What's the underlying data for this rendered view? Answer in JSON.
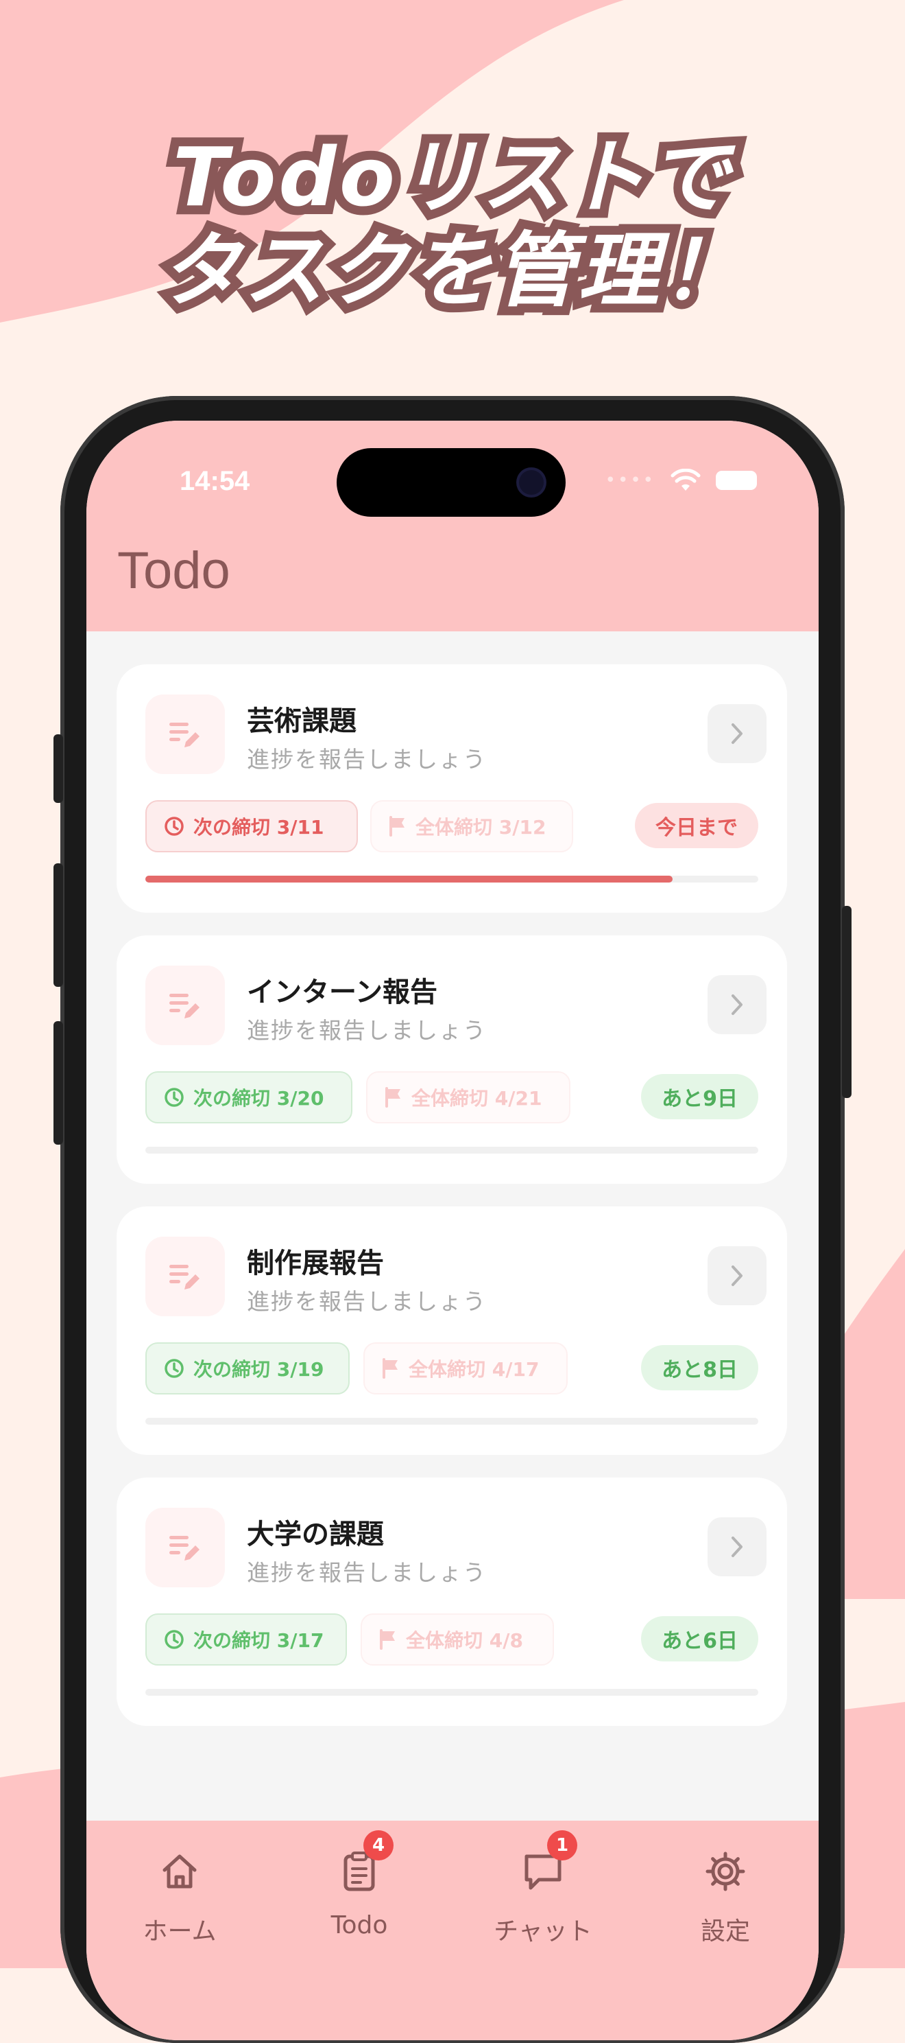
{
  "promo": {
    "headline_line1": "Todoリストで",
    "headline_line2": "タスクを管理！"
  },
  "status_bar": {
    "time": "14:54",
    "signal_dots": "••••"
  },
  "header": {
    "title": "Todo"
  },
  "cards": [
    {
      "title": "芸術課題",
      "subtitle": "進捗を報告しましょう",
      "next_deadline": "次の締切 3/11",
      "final_deadline": "全体締切 3/12",
      "remaining": "今日まで",
      "status": "red",
      "progress": 0.86
    },
    {
      "title": "インターン報告",
      "subtitle": "進捗を報告しましょう",
      "next_deadline": "次の締切 3/20",
      "final_deadline": "全体締切 4/21",
      "remaining": "あと9日",
      "status": "green",
      "progress": 0
    },
    {
      "title": "制作展報告",
      "subtitle": "進捗を報告しましょう",
      "next_deadline": "次の締切 3/19",
      "final_deadline": "全体締切 4/17",
      "remaining": "あと8日",
      "status": "green",
      "progress": 0
    },
    {
      "title": "大学の課題",
      "subtitle": "進捗を報告しましょう",
      "next_deadline": "次の締切 3/17",
      "final_deadline": "全体締切 4/8",
      "remaining": "あと6日",
      "status": "green",
      "progress": 0
    }
  ],
  "tab_bar": [
    {
      "label": "ホーム",
      "icon": "home-icon",
      "count": ""
    },
    {
      "label": "Todo",
      "icon": "clipboard-icon",
      "count": "4"
    },
    {
      "label": "チャット",
      "icon": "chat-bubble-icon",
      "count": "1"
    },
    {
      "label": "設定",
      "icon": "gear-icon",
      "count": ""
    }
  ],
  "colors": {
    "accent_pink": "#fdc3c3",
    "title_brown": "#8a5858",
    "urgent_red": "#e45d5d",
    "ok_green": "#5fbf6b",
    "badge_red": "#ef4b4b"
  }
}
